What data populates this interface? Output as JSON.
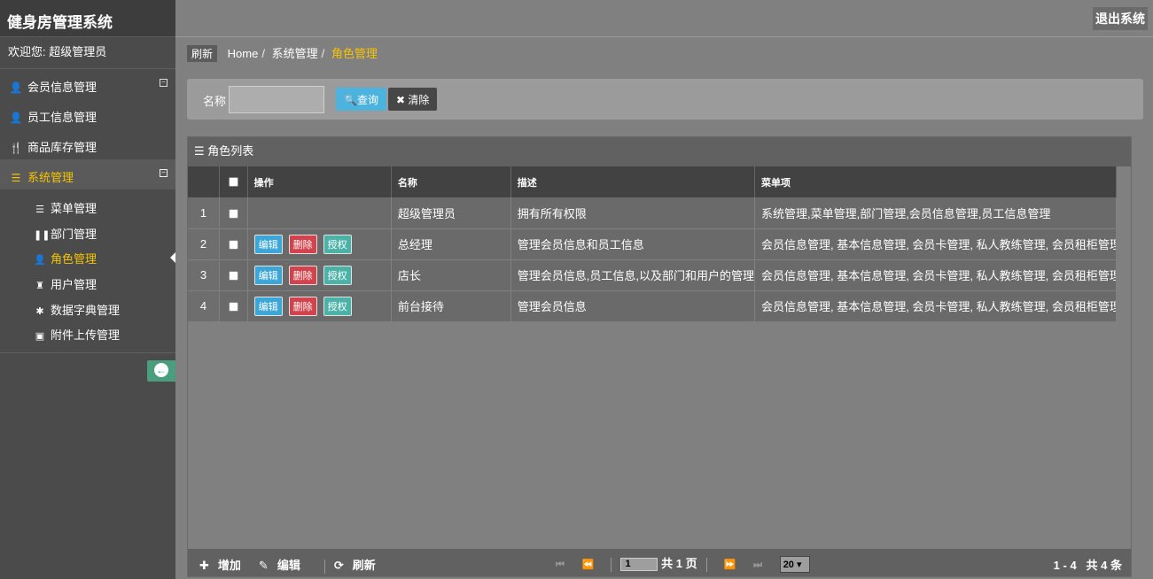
{
  "app": {
    "title": "健身房管理系统",
    "logout_label": "退出系统"
  },
  "user": {
    "welcome": "欢迎您: 超级管理员"
  },
  "sidebar": {
    "items": [
      {
        "label": "会员信息管理",
        "icon": "user-icon",
        "glyph": "👤",
        "collapsible": true
      },
      {
        "label": "员工信息管理",
        "icon": "user-icon",
        "glyph": "👤",
        "collapsible": false
      },
      {
        "label": "商品库存管理",
        "icon": "cutlery-icon",
        "glyph": "🍴",
        "collapsible": false
      },
      {
        "label": "系统管理",
        "icon": "list-icon",
        "glyph": "☰",
        "collapsible": true,
        "active": true
      }
    ],
    "subitems": [
      {
        "label": "菜单管理",
        "glyph": "☰",
        "icon": "list-icon"
      },
      {
        "label": "部门管理",
        "glyph": "❚❚",
        "icon": "pause-icon"
      },
      {
        "label": "角色管理",
        "glyph": "👤",
        "icon": "user-icon",
        "active": true
      },
      {
        "label": "用户管理",
        "glyph": "♜",
        "icon": "tower-icon"
      },
      {
        "label": "数据字典管理",
        "glyph": "✱",
        "icon": "cog-icon"
      },
      {
        "label": "附件上传管理",
        "glyph": "▣",
        "icon": "briefcase-icon"
      }
    ]
  },
  "breadcrumb": {
    "refresh_label": "刷新",
    "items": [
      "Home",
      "系统管理"
    ],
    "current": "角色管理"
  },
  "search": {
    "label": "名称",
    "value": "",
    "query_label": "查询",
    "clear_label": "清除"
  },
  "grid": {
    "title": "角色列表",
    "columns": [
      "操作",
      "名称",
      "描述",
      "菜单项"
    ],
    "op_labels": {
      "edit": "编辑",
      "delete": "删除",
      "auth": "授权"
    },
    "rows": [
      {
        "num": "1",
        "ops": false,
        "name": "超级管理员",
        "desc": "拥有所有权限",
        "menus": "系统管理,菜单管理,部门管理,会员信息管理,员工信息管理"
      },
      {
        "num": "2",
        "ops": true,
        "name": "总经理",
        "desc": "管理会员信息和员工信息",
        "menus": "会员信息管理, 基本信息管理, 会员卡管理, 私人教练管理, 会员租柜管理,"
      },
      {
        "num": "3",
        "ops": true,
        "name": "店长",
        "desc": "管理会员信息,员工信息,以及部门和用户的管理",
        "menus": "会员信息管理, 基本信息管理, 会员卡管理, 私人教练管理, 会员租柜管理,"
      },
      {
        "num": "4",
        "ops": true,
        "name": "前台接待",
        "desc": "管理会员信息",
        "menus": "会员信息管理, 基本信息管理, 会员卡管理, 私人教练管理, 会员租柜管理"
      }
    ]
  },
  "footer": {
    "add_label": "增加",
    "edit_label": "编辑",
    "refresh_label": "刷新",
    "page_value": "1",
    "total_pages": "共 1 页",
    "page_size": "20",
    "range": "1 - 4",
    "total": "共 4 条"
  }
}
